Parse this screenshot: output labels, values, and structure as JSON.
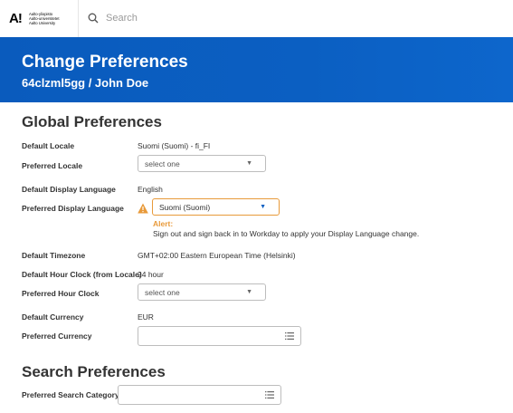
{
  "header": {
    "logo_letters": "A!",
    "logo_lines": [
      "Aalto-yliopisto",
      "Aalto-universitetet",
      "Aalto University"
    ],
    "search_placeholder": "Search"
  },
  "banner": {
    "title": "Change Preferences",
    "subtitle": "64clzml5gg / John Doe"
  },
  "global": {
    "title": "Global Preferences",
    "default_locale_label": "Default Locale",
    "default_locale_value": "Suomi (Suomi) - fi_FI",
    "preferred_locale_label": "Preferred Locale",
    "preferred_locale_value": "select one",
    "default_display_language_label": "Default Display Language",
    "default_display_language_value": "English",
    "preferred_display_language_label": "Preferred Display Language",
    "preferred_display_language_value": "Suomi (Suomi)",
    "alert_title": "Alert:",
    "alert_message": "Sign out and sign back in to Workday to apply your Display Language change.",
    "default_timezone_label": "Default Timezone",
    "default_timezone_value": "GMT+02:00 Eastern European Time (Helsinki)",
    "default_hour_clock_label": "Default Hour Clock (from Locale)",
    "default_hour_clock_value": "24 hour",
    "preferred_hour_clock_label": "Preferred Hour Clock",
    "preferred_hour_clock_value": "select one",
    "default_currency_label": "Default Currency",
    "default_currency_value": "EUR",
    "preferred_currency_label": "Preferred Currency",
    "preferred_currency_value": ""
  },
  "search_prefs": {
    "title": "Search Preferences",
    "preferred_search_category_label": "Preferred Search Category",
    "preferred_search_category_value": ""
  },
  "colors": {
    "banner": "#0b5fc2",
    "alert": "#e89a3a"
  }
}
